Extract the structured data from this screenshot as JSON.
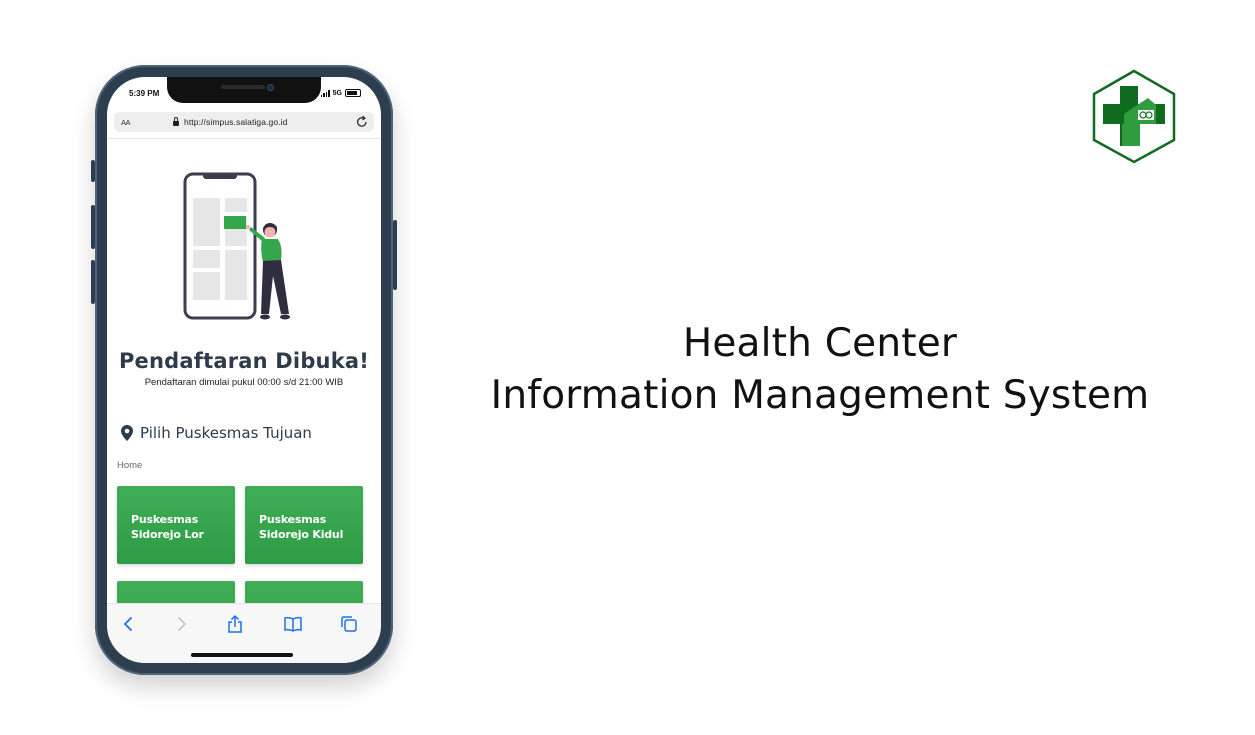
{
  "status_bar": {
    "time": "5:39 PM",
    "network": "5G"
  },
  "browser": {
    "text_size_label": "AA",
    "url": "http://simpus.salatiga.go.id"
  },
  "page": {
    "title": "Pendaftaran Dibuka!",
    "subtitle": "Pendaftaran dimulai pukul 00:00 s/d 21:00 WIB",
    "location_heading": "Pilih Puskesmas Tujuan",
    "breadcrumb": "Home",
    "cards": [
      {
        "line1": "Puskesmas",
        "line2": "Sidorejo Lor"
      },
      {
        "line1": "Puskesmas",
        "line2": "Sidorejo Kidul"
      }
    ]
  },
  "toolbar": {
    "icons": [
      "back-icon",
      "forward-icon",
      "share-icon",
      "bookmarks-icon",
      "tabs-icon"
    ]
  },
  "hero": {
    "line1": "Health Center",
    "line2": "Information Management System"
  },
  "colors": {
    "accent_green": "#35a64c",
    "logo_dark_green": "#0e6b1f",
    "title_text": "#2e3b4a"
  }
}
